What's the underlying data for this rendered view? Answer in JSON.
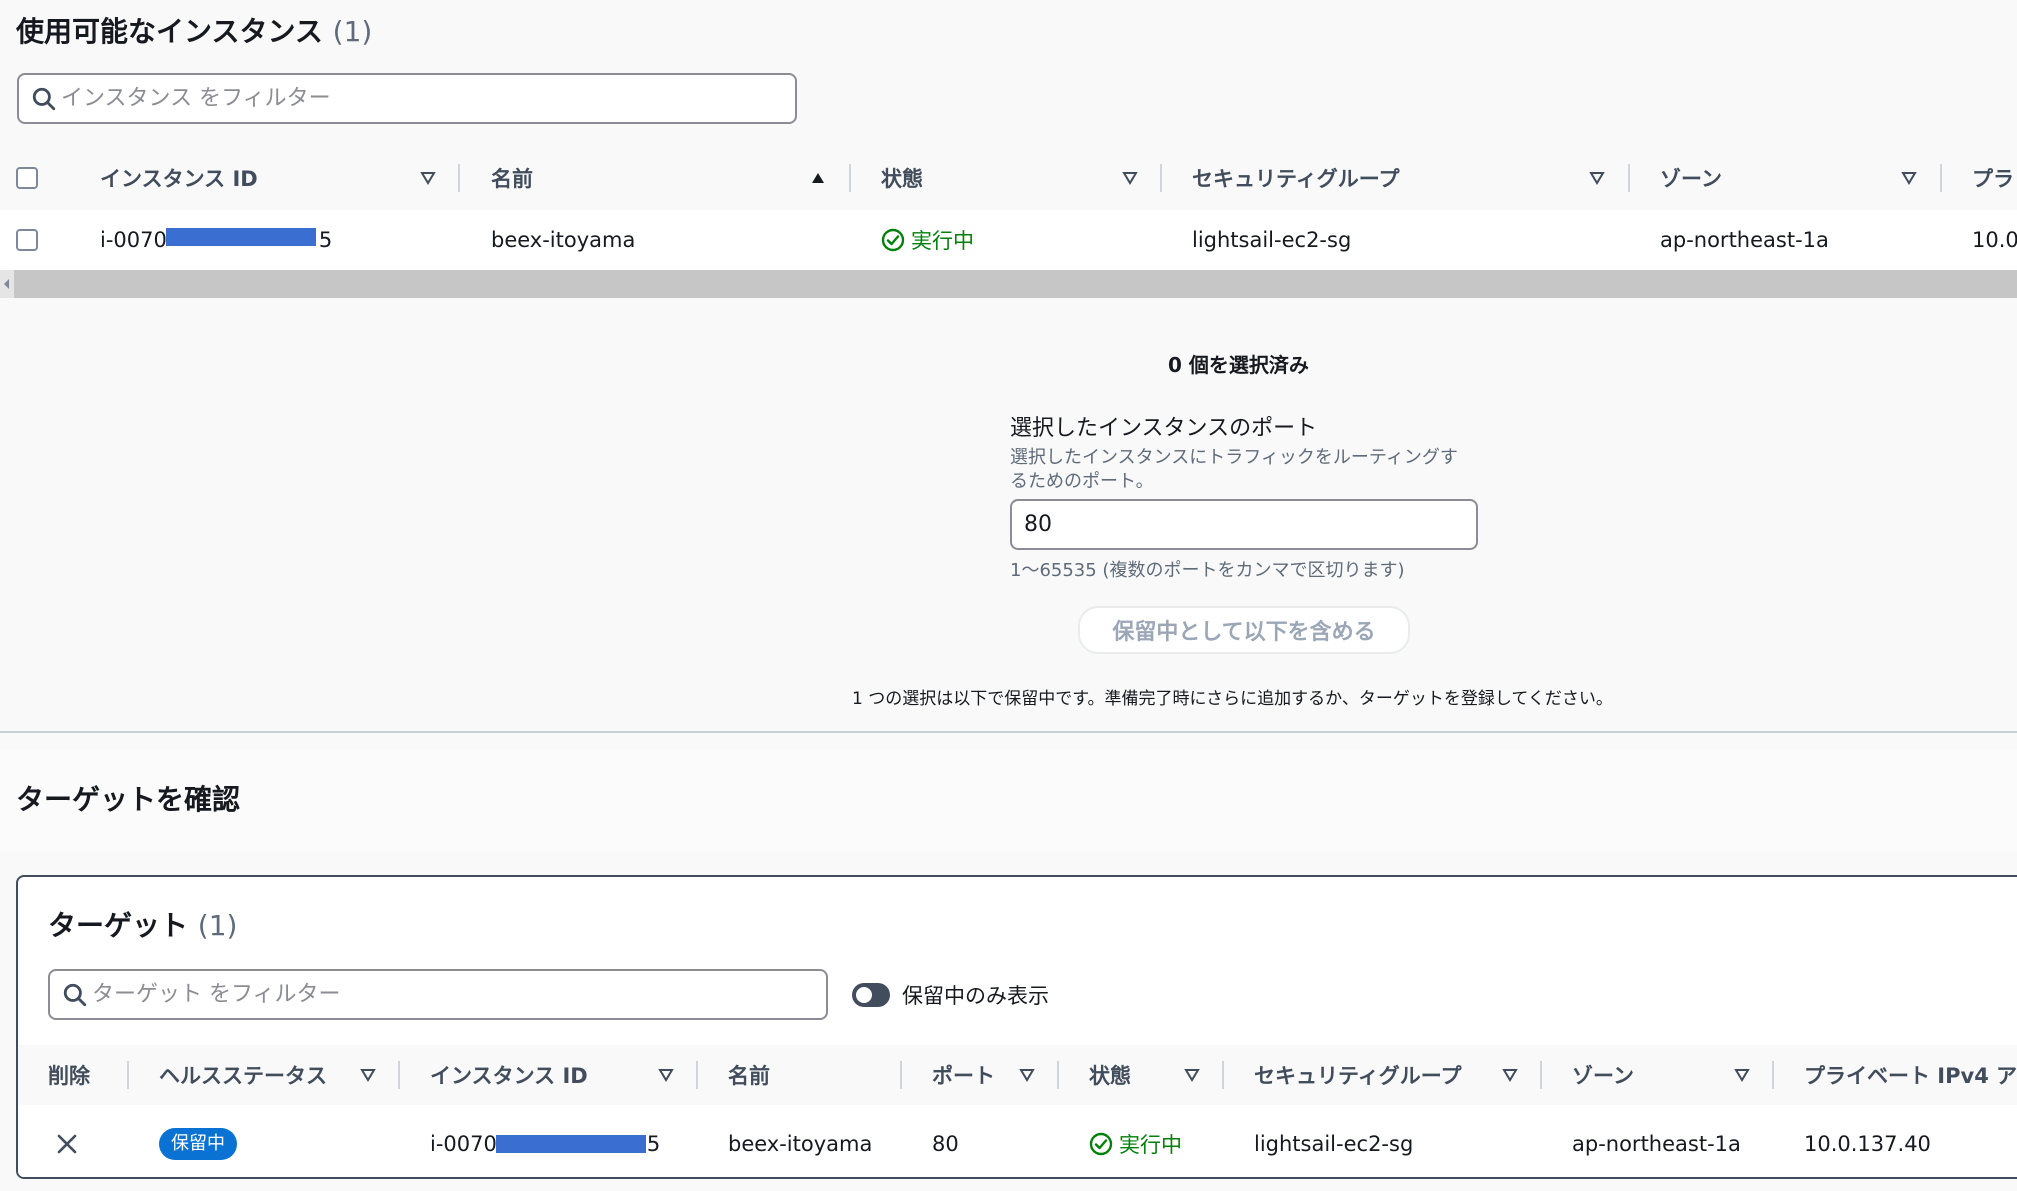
{
  "available": {
    "title": "使用可能なインスタンス",
    "count": "(1)",
    "filter_placeholder": "インスタンス をフィルター",
    "columns": [
      "インスタンス ID",
      "名前",
      "状態",
      "セキュリティグループ",
      "ゾーン",
      "プラ"
    ],
    "row": {
      "instance_id": "i-0070",
      "instance_id_tail": "5",
      "name": "beex-itoyama",
      "state": "実行中",
      "security_group": "lightsail-ec2-sg",
      "zone": "ap-northeast-1a",
      "private_ip": "10.0"
    }
  },
  "selection": {
    "selected_count": "0 個を選択済み",
    "port_label": "選択したインスタンスのポート",
    "port_desc_line1": "選択したインスタンスにトラフィックをルーティングす",
    "port_desc_line2": "るためのポート。",
    "port_value": "80",
    "port_hint": "1～65535 (複数のポートをカンマで区切ります)",
    "include_button": "保留中として以下を含める",
    "pending_note": "1 つの選択は以下で保留中です。準備完了時にさらに追加するか、ターゲットを登録してください。"
  },
  "review": {
    "title": "ターゲットを確認"
  },
  "targets": {
    "title": "ターゲット",
    "count": "(1)",
    "filter_placeholder": "ターゲット をフィルター",
    "toggle_label": "保留中のみ表示",
    "columns": [
      "削除",
      "ヘルスステータス",
      "インスタンス ID",
      "名前",
      "ポート",
      "状態",
      "セキュリティグループ",
      "ゾーン",
      "プライベート IPv4 ア"
    ],
    "row": {
      "health": "保留中",
      "instance_id": "i-0070",
      "instance_id_tail": "5",
      "name": "beex-itoyama",
      "port": "80",
      "state": "実行中",
      "security_group": "lightsail-ec2-sg",
      "zone": "ap-northeast-1a",
      "private_ip": "10.0.137.40"
    }
  },
  "colors": {
    "success": "#037f0c",
    "pending_badge": "#0972d3",
    "redaction": "#3a6fd1"
  }
}
